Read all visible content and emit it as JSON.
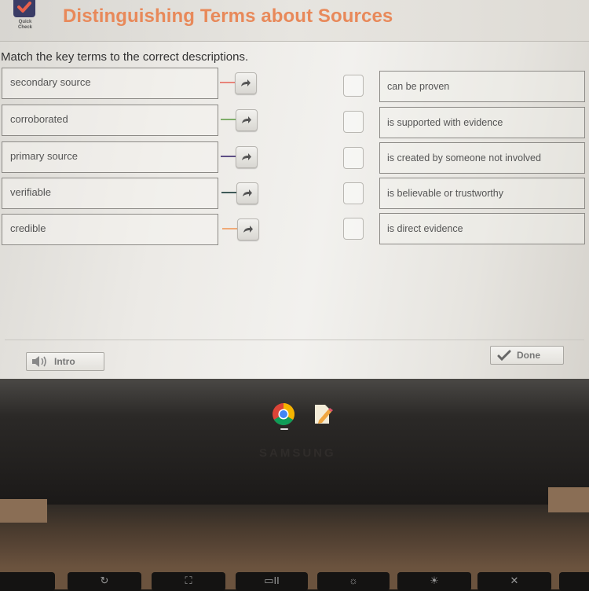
{
  "header": {
    "badge_icon": "checkmark-icon",
    "badge_label_line1": "Quick",
    "badge_label_line2": "Check",
    "title": "Distinguishing Terms about Sources"
  },
  "instructions": "Match the key terms to the correct descriptions.",
  "terms": [
    {
      "label": "secondary source",
      "connector_color": "#e8847a"
    },
    {
      "label": "corroborated",
      "connector_color": "#7fae6a"
    },
    {
      "label": "primary source",
      "connector_color": "#5e4f86"
    },
    {
      "label": "verifiable",
      "connector_color": "#3f5a58"
    },
    {
      "label": "credible",
      "connector_color": "#f0aa78"
    }
  ],
  "descriptions": [
    {
      "label": "can be proven"
    },
    {
      "label": "is supported with evidence"
    },
    {
      "label": "is created by someone not involved"
    },
    {
      "label": "is believable or trustworthy"
    },
    {
      "label": "is direct evidence"
    }
  ],
  "footer": {
    "intro_label": "Intro",
    "intro_icon": "speaker-icon",
    "done_label": "Done",
    "done_icon": "checkmark-icon"
  },
  "shelf": {
    "apps": [
      {
        "name": "Chrome",
        "icon": "chrome-icon"
      },
      {
        "name": "Text editor",
        "icon": "text-editor-icon"
      }
    ]
  },
  "device": {
    "brand": "SAMSUNG"
  },
  "keyboard": {
    "keys": [
      "↻",
      "⛶",
      "▭II",
      "☼",
      "☀",
      "✕"
    ]
  }
}
